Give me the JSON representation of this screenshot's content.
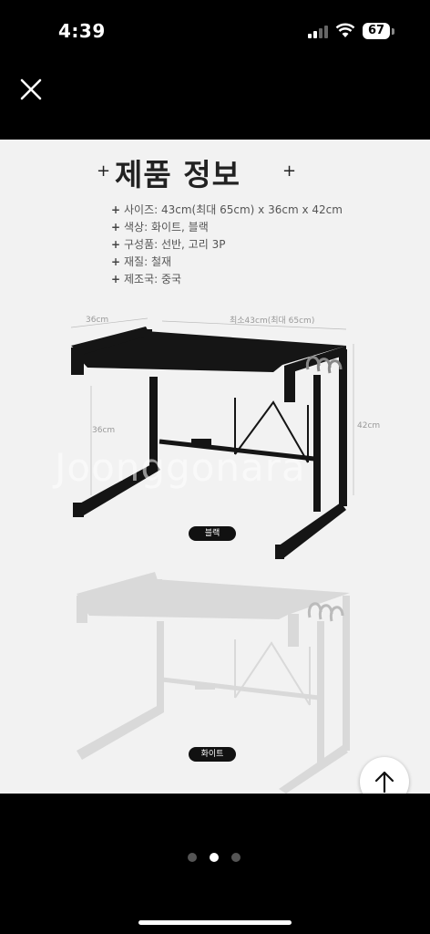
{
  "status_bar": {
    "time": "4:39",
    "battery": "67"
  },
  "product_image": {
    "title": "제품 정보",
    "plus_left": "+",
    "plus_right": "+",
    "specs": [
      "사이즈: 43cm(최대 65cm) x 36cm x 42cm",
      "색상:  화이트, 블랙",
      "구성품: 선반, 고리 3P",
      "재질:  철재",
      "제조국: 중국"
    ],
    "dimensions": {
      "depth": "36cm",
      "width": "최소43cm(최대 65cm)",
      "side_height": "36cm",
      "height": "42cm"
    },
    "watermark": "Joonggonara",
    "labels": {
      "black": "블랙",
      "white": "화이트"
    }
  },
  "pagination": {
    "total": 3,
    "active_index": 1
  },
  "icons": {
    "close": "close-icon",
    "scroll_top": "arrow-up-icon"
  },
  "colors": {
    "background": "#000000",
    "image_bg": "#f2f2f2",
    "rack_black": "#151515",
    "rack_white": "#d8d8d8"
  }
}
